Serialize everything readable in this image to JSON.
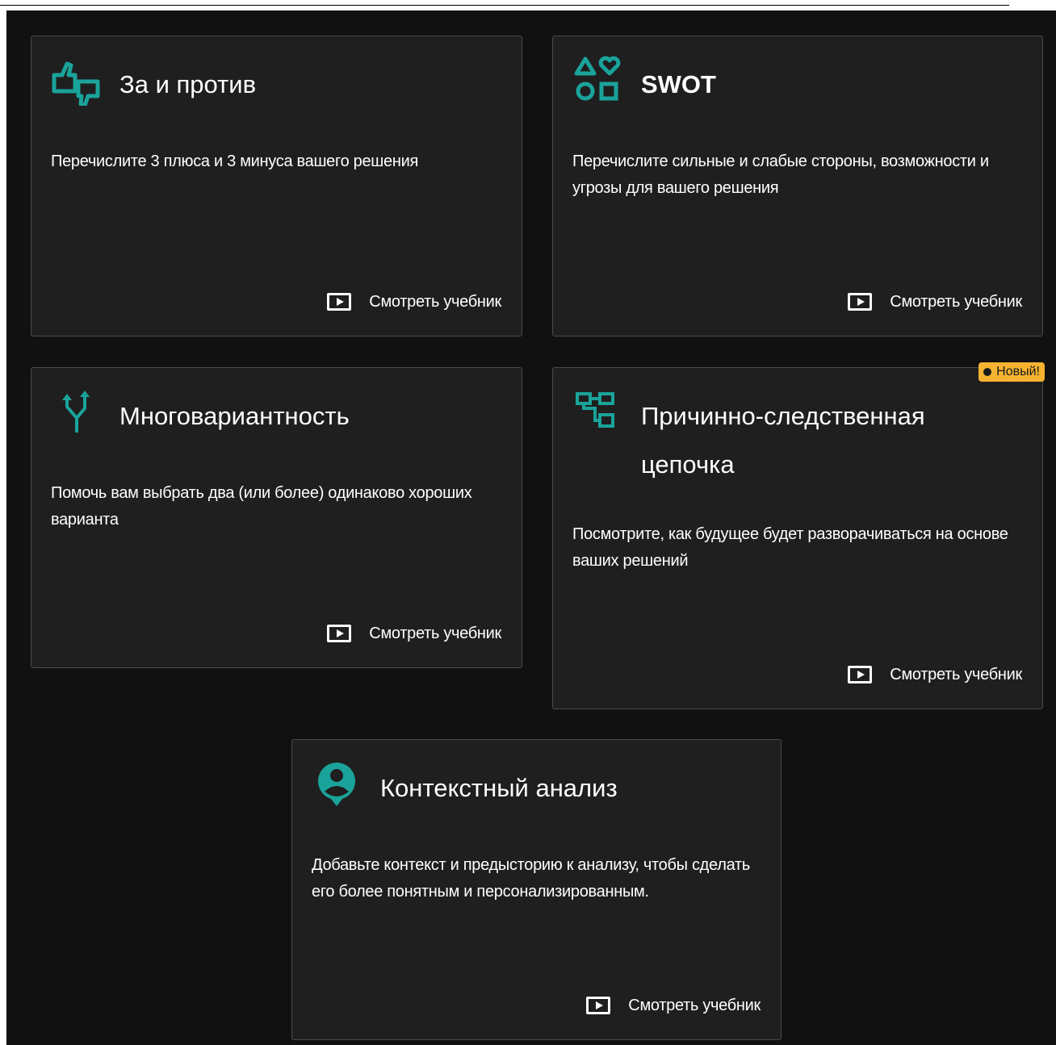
{
  "colors": {
    "accent": "#1aa39a",
    "badge": "#f5b330",
    "card_bg": "#1f1f1f",
    "page_bg": "#111111"
  },
  "cards": [
    {
      "icon": "thumbs-up-down-icon",
      "title": "За и против",
      "description": "Перечислите 3 плюса и 3 минуса вашего решения",
      "tutorial_label": "Смотреть учебник"
    },
    {
      "icon": "shapes-icon",
      "title": "SWOT",
      "description": "Перечислите сильные и слабые стороны, возможности и угрозы для вашего решения",
      "tutorial_label": "Смотреть учебник"
    },
    {
      "icon": "split-arrows-icon",
      "title": "Многовариантность",
      "description": "Помочь вам выбрать два (или более) одинаково хороших варианта",
      "tutorial_label": "Смотреть учебник"
    },
    {
      "icon": "flowchart-icon",
      "title": "Причинно-следственная цепочка",
      "description": "Посмотрите, как будущее будет разворачиваться на основе ваших решений",
      "tutorial_label": "Смотреть учебник",
      "badge": "Новый!"
    },
    {
      "icon": "person-pin-icon",
      "title": "Контекстный анализ",
      "description": "Добавьте контекст и предысторию к анализу, чтобы сделать его более понятным и персонализированным.",
      "tutorial_label": "Смотреть учебник"
    }
  ]
}
